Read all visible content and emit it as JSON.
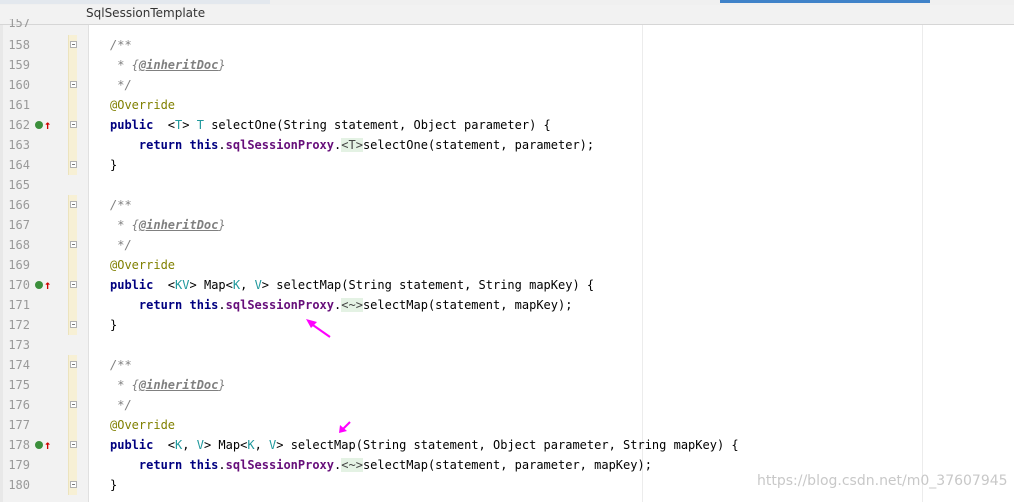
{
  "editor": {
    "file_tab": "SqlSessionTemplate",
    "partial_top_line": "157"
  },
  "lines": [
    {
      "num": "158",
      "parts": [
        [
          "cmt",
          "/**"
        ]
      ]
    },
    {
      "num": "159",
      "parts": [
        [
          "cmt",
          " * {"
        ],
        [
          "tag",
          "@inheritDoc"
        ],
        [
          "cmt",
          "}"
        ]
      ]
    },
    {
      "num": "160",
      "parts": [
        [
          "cmt",
          " */"
        ]
      ]
    },
    {
      "num": "161",
      "parts": [
        [
          "ann",
          "@Override"
        ]
      ]
    },
    {
      "num": "162",
      "icon": true,
      "parts": [
        [
          "kw",
          "public"
        ],
        [
          "",
          "  <"
        ],
        [
          "tp",
          "T"
        ],
        [
          "",
          "> "
        ],
        [
          "tp",
          "T"
        ],
        [
          "",
          " selectOne(String statement, Object parameter) {"
        ]
      ]
    },
    {
      "num": "163",
      "parts": [
        [
          "",
          "    "
        ],
        [
          "kw",
          "return"
        ],
        [
          "",
          " "
        ],
        [
          "kw",
          "this"
        ],
        [
          "",
          "."
        ],
        [
          "fld",
          "sqlSessionProxy"
        ],
        [
          "",
          "."
        ],
        [
          "fold",
          "<T>"
        ],
        [
          "",
          "selectOne(statement, parameter);"
        ]
      ]
    },
    {
      "num": "164",
      "parts": [
        [
          "",
          "}"
        ]
      ]
    },
    {
      "num": "165",
      "parts": []
    },
    {
      "num": "166",
      "parts": [
        [
          "cmt",
          "/**"
        ]
      ]
    },
    {
      "num": "167",
      "parts": [
        [
          "cmt",
          " * {"
        ],
        [
          "tag",
          "@inheritDoc"
        ],
        [
          "cmt",
          "}"
        ]
      ]
    },
    {
      "num": "168",
      "parts": [
        [
          "cmt",
          " */"
        ]
      ]
    },
    {
      "num": "169",
      "parts": [
        [
          "ann",
          "@Override"
        ]
      ]
    },
    {
      "num": "170",
      "icon": true,
      "parts": [
        [
          "kw",
          "public"
        ],
        [
          "",
          "  <"
        ],
        [
          "tp",
          "K"
        ],
        [
          ", "
        ],
        [
          "tp",
          "V"
        ],
        [
          "",
          "> Map<"
        ],
        [
          "tp",
          "K"
        ],
        [
          "",
          ", "
        ],
        [
          "tp",
          "V"
        ],
        [
          "",
          "> selectMap(String statement, String mapKey) {"
        ]
      ]
    },
    {
      "num": "171",
      "parts": [
        [
          "",
          "    "
        ],
        [
          "kw",
          "return"
        ],
        [
          "",
          " "
        ],
        [
          "kw",
          "this"
        ],
        [
          "",
          "."
        ],
        [
          "fld",
          "sqlSessionProxy"
        ],
        [
          "",
          "."
        ],
        [
          "fold",
          "<~>"
        ],
        [
          "",
          "selectMap(statement, mapKey);"
        ]
      ]
    },
    {
      "num": "172",
      "parts": [
        [
          "",
          "}"
        ]
      ]
    },
    {
      "num": "173",
      "parts": []
    },
    {
      "num": "174",
      "parts": [
        [
          "cmt",
          "/**"
        ]
      ]
    },
    {
      "num": "175",
      "parts": [
        [
          "cmt",
          " * {"
        ],
        [
          "tag",
          "@inheritDoc"
        ],
        [
          "cmt",
          "}"
        ]
      ]
    },
    {
      "num": "176",
      "parts": [
        [
          "cmt",
          " */"
        ]
      ]
    },
    {
      "num": "177",
      "parts": [
        [
          "ann",
          "@Override"
        ]
      ]
    },
    {
      "num": "178",
      "icon": true,
      "parts": [
        [
          "kw",
          "public"
        ],
        [
          "",
          "  <"
        ],
        [
          "tp",
          "K"
        ],
        [
          "",
          ", "
        ],
        [
          "tp",
          "V"
        ],
        [
          "",
          "> Map<"
        ],
        [
          "tp",
          "K"
        ],
        [
          "",
          ", "
        ],
        [
          "tp",
          "V"
        ],
        [
          "",
          "> selectMap(String statement, Object parameter, String mapKey) {"
        ]
      ]
    },
    {
      "num": "179",
      "parts": [
        [
          "",
          "    "
        ],
        [
          "kw",
          "return"
        ],
        [
          "",
          " "
        ],
        [
          "kw",
          "this"
        ],
        [
          "",
          "."
        ],
        [
          "fld",
          "sqlSessionProxy"
        ],
        [
          "",
          "."
        ],
        [
          "fold",
          "<~>"
        ],
        [
          "",
          "selectMap(statement, parameter, mapKey);"
        ]
      ]
    },
    {
      "num": "180",
      "parts": [
        [
          "",
          "}"
        ]
      ]
    }
  ],
  "watermark": "https://blog.csdn.net/m0_37607945",
  "colors": {
    "arrow": "#ff00ff",
    "keyword": "#000080",
    "annotation": "#808000",
    "field": "#660e7a",
    "typeparam": "#20999d"
  }
}
